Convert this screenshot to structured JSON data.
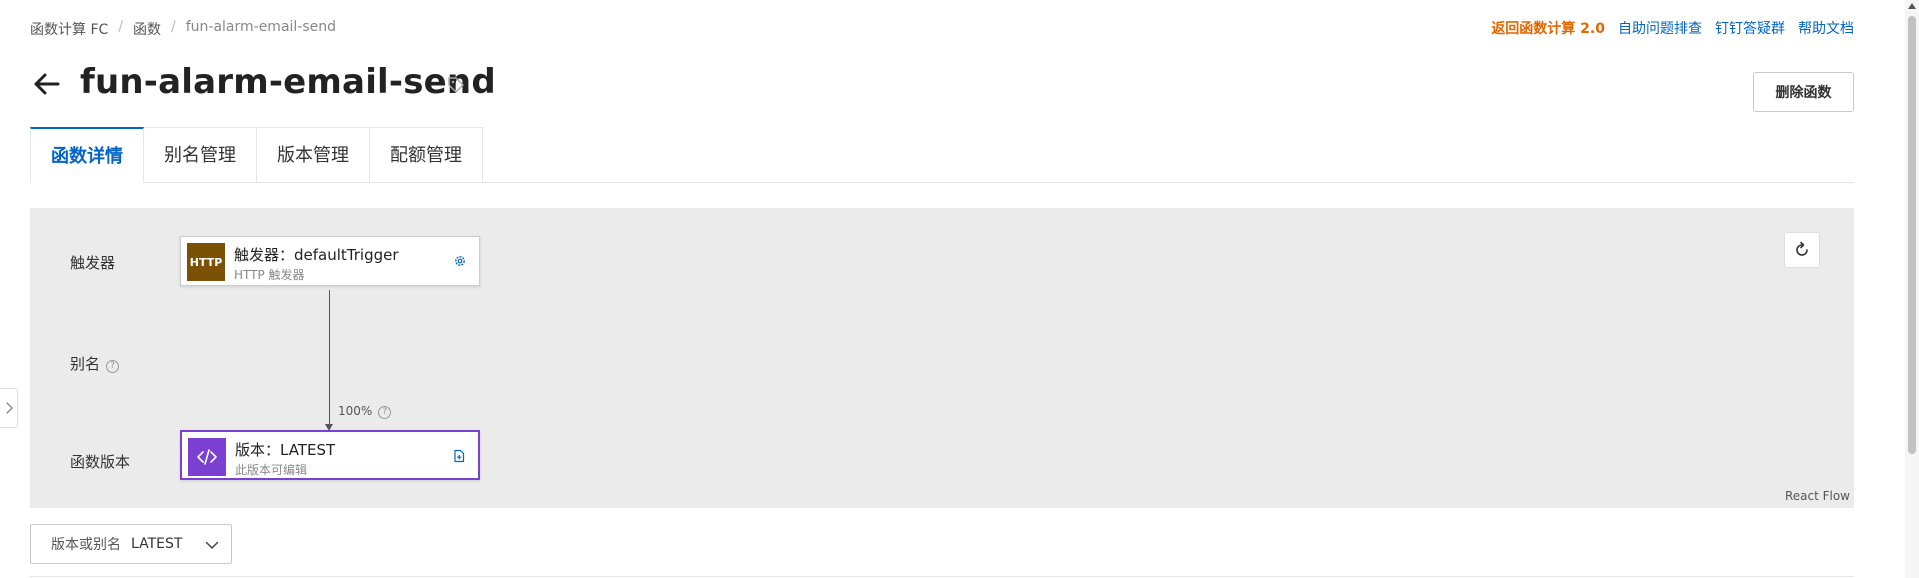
{
  "breadcrumb": {
    "items": [
      "函数计算 FC",
      "函数",
      "fun-alarm-email-send"
    ]
  },
  "toplinks": {
    "back_v2": "返回函数计算 2.0",
    "self_check": "自助问题排查",
    "dingtalk": "钉钉答疑群",
    "docs": "帮助文档"
  },
  "page": {
    "title": "fun-alarm-email-send",
    "delete_label": "删除函数"
  },
  "tabs": [
    {
      "label": "函数详情",
      "active": true
    },
    {
      "label": "别名管理",
      "active": false
    },
    {
      "label": "版本管理",
      "active": false
    },
    {
      "label": "配额管理",
      "active": false
    }
  ],
  "flow": {
    "rows": {
      "trigger": "触发器",
      "alias": "别名",
      "version": "函数版本"
    },
    "trigger_node": {
      "badge": "HTTP",
      "title": "触发器：defaultTrigger",
      "subtitle": "HTTP 触发器"
    },
    "version_node": {
      "title": "版本：LATEST",
      "subtitle": "此版本可编辑"
    },
    "traffic_percent": "100%",
    "watermark": "React Flow"
  },
  "version_select": {
    "label": "版本或别名",
    "value": "LATEST"
  },
  "colors": {
    "accent": "#0064c8",
    "orange": "#e56600",
    "http_badge": "#7a5105",
    "version_purple": "#7b3fd1"
  }
}
